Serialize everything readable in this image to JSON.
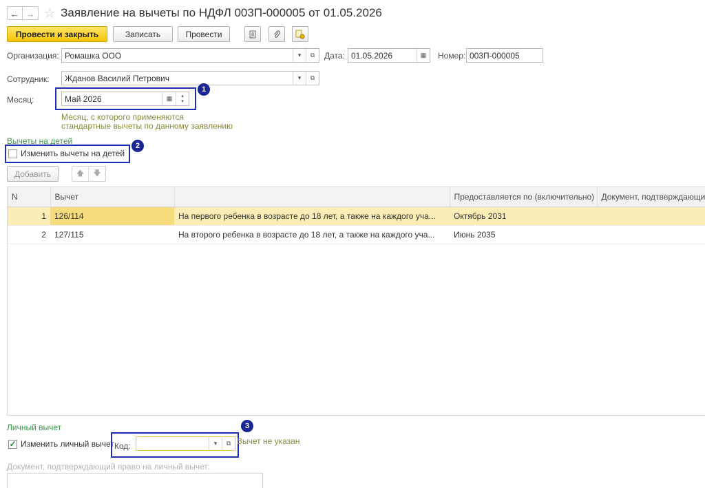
{
  "header": {
    "title": "Заявление на вычеты по НДФЛ 003П-000005 от 01.05.2026",
    "back_icon": "←",
    "forward_icon": "→",
    "star_icon": "☆"
  },
  "toolbar": {
    "post_close": "Провести и закрыть",
    "save": "Записать",
    "post": "Провести"
  },
  "form": {
    "org_label": "Организация:",
    "org_value": "Ромашка ООО",
    "date_label": "Дата:",
    "date_value": "01.05.2026",
    "number_label": "Номер:",
    "number_value": "003П-000005",
    "employee_label": "Сотрудник:",
    "employee_value": "Жданов Василий Петрович",
    "month_label": "Месяц:",
    "month_value": "Май 2026",
    "month_hint_1": "Месяц, с которого применяются",
    "month_hint_2": "стандартные вычеты по данному заявлению"
  },
  "children": {
    "section_title": "Вычеты на детей",
    "change_checkbox": "Изменить вычеты на детей",
    "add_button": "Добавить",
    "up_icon": "🡅",
    "down_icon": "🡇"
  },
  "table": {
    "headers": [
      "N",
      "Вычет",
      "",
      "Предоставляется по (включительно)",
      "Документ, подтверждающий"
    ],
    "rows": [
      {
        "n": "1",
        "code": "126/114",
        "desc": "На первого ребенка в возрасте до 18 лет, а также на каждого уча...",
        "until": "Октябрь 2031",
        "doc": ""
      },
      {
        "n": "2",
        "code": "127/115",
        "desc": "На второго ребенка в возрасте до 18 лет, а также на каждого уча...",
        "until": "Июнь 2035",
        "doc": ""
      }
    ]
  },
  "personal": {
    "section_title": "Личный вычет",
    "change_checkbox": "Изменить личный вычет",
    "code_label": "Код:",
    "code_value": "",
    "not_specified": "Вычет не указан",
    "doc_label": "Документ, подтверждающий право на личный вычет:",
    "doc_value": ""
  },
  "badges": [
    "1",
    "2",
    "3"
  ],
  "colors": {
    "primary_button": "#f5c400",
    "highlight_frame": "#1c2db8",
    "badge": "#1a2596",
    "section_green": "#3c9a4a",
    "selected_row": "#fbedb5"
  }
}
